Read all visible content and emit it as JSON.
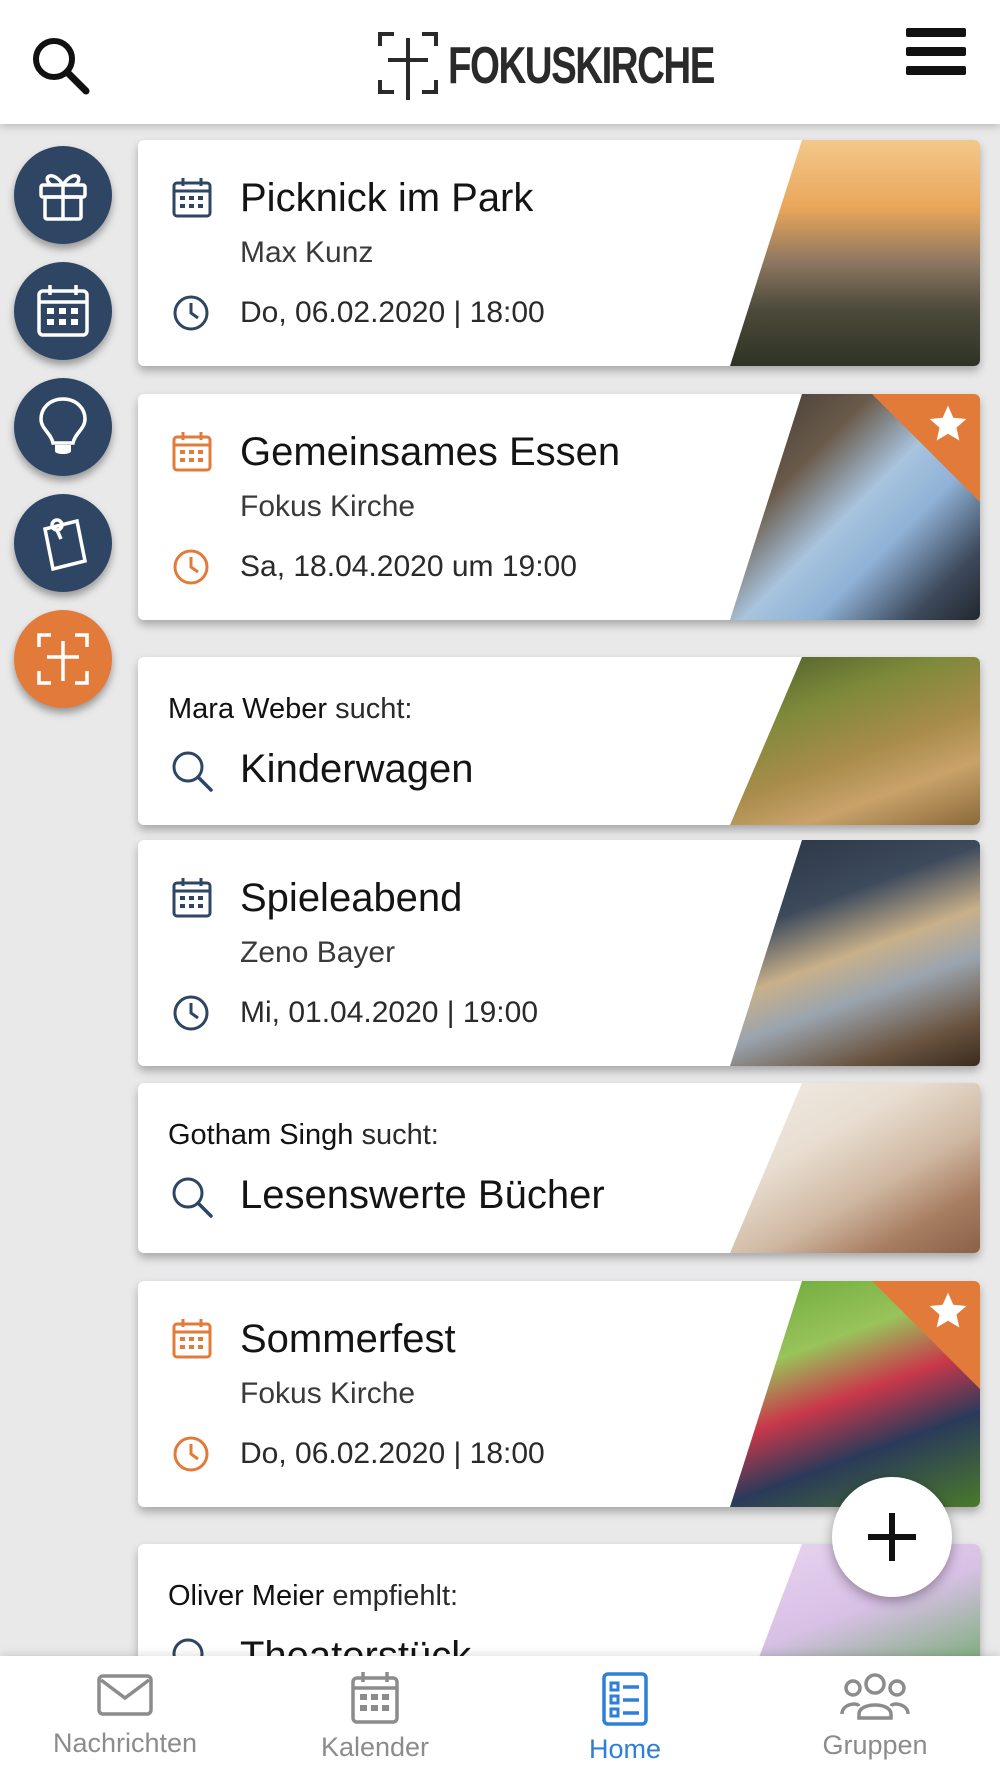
{
  "header": {
    "logo_text": "FOKUSKIRCHE"
  },
  "side_actions": [
    {
      "icon": "gift-icon"
    },
    {
      "icon": "calendar-icon"
    },
    {
      "icon": "lightbulb-icon"
    },
    {
      "icon": "note-icon"
    },
    {
      "icon": "fokus-cross-icon",
      "color": "#e27b3a"
    }
  ],
  "feed": [
    {
      "type": "event",
      "title": "Picknick im Park",
      "subtitle": "Max Kunz",
      "when": "Do, 06.02.2020 | 18:00",
      "accent": "#2e4663"
    },
    {
      "type": "event",
      "title": "Gemeinsames Essen",
      "subtitle": "Fokus Kirche",
      "when": "Sa, 18.04.2020 um 19:00",
      "accent": "#e27b3a",
      "featured": true
    },
    {
      "type": "search",
      "name": "Mara Weber",
      "verb": "sucht:",
      "title": "Kinderwagen"
    },
    {
      "type": "event",
      "title": "Spieleabend",
      "subtitle": "Zeno Bayer",
      "when": "Mi, 01.04.2020 | 19:00",
      "accent": "#2e4663"
    },
    {
      "type": "search",
      "name": "Gotham Singh",
      "verb": "sucht:",
      "title": "Lesenswerte Bücher"
    },
    {
      "type": "event",
      "title": "Sommerfest",
      "subtitle": "Fokus Kirche",
      "when": "Do, 06.02.2020 | 18:00",
      "accent": "#e27b3a",
      "featured": true
    },
    {
      "type": "recommend",
      "name": "Oliver Meier",
      "verb": "empfiehlt:",
      "title": "Theaterstück"
    }
  ],
  "bottom_nav": [
    {
      "label": "Nachrichten",
      "icon": "mail-icon"
    },
    {
      "label": "Kalender",
      "icon": "calendar-icon"
    },
    {
      "label": "Home",
      "icon": "home-list-icon",
      "active": true
    },
    {
      "label": "Gruppen",
      "icon": "group-icon"
    }
  ],
  "colors": {
    "navy": "#2e4663",
    "orange": "#e27b3a",
    "active_blue": "#2d7fd8"
  }
}
